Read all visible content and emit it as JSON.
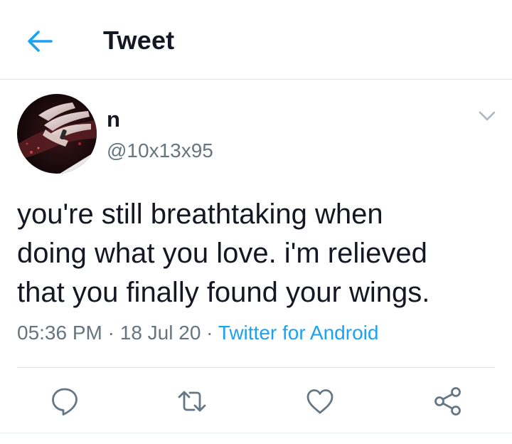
{
  "header": {
    "title": "Tweet",
    "back_icon": "arrow-left-icon",
    "accent_color": "#1da1f2"
  },
  "tweet": {
    "display_name": "n",
    "handle": "@10x13x95",
    "text": "you're still breathtaking when\ndoing what you love. i'm relieved\nthat you finally found your wings.",
    "time": "05:36 PM",
    "date": "18 Jul 20",
    "separator": "·",
    "source": "Twitter for Android"
  },
  "actions": [
    {
      "name": "reply",
      "icon": "comment-icon"
    },
    {
      "name": "retweet",
      "icon": "retweet-icon"
    },
    {
      "name": "like",
      "icon": "heart-icon"
    },
    {
      "name": "share",
      "icon": "share-icon"
    }
  ]
}
